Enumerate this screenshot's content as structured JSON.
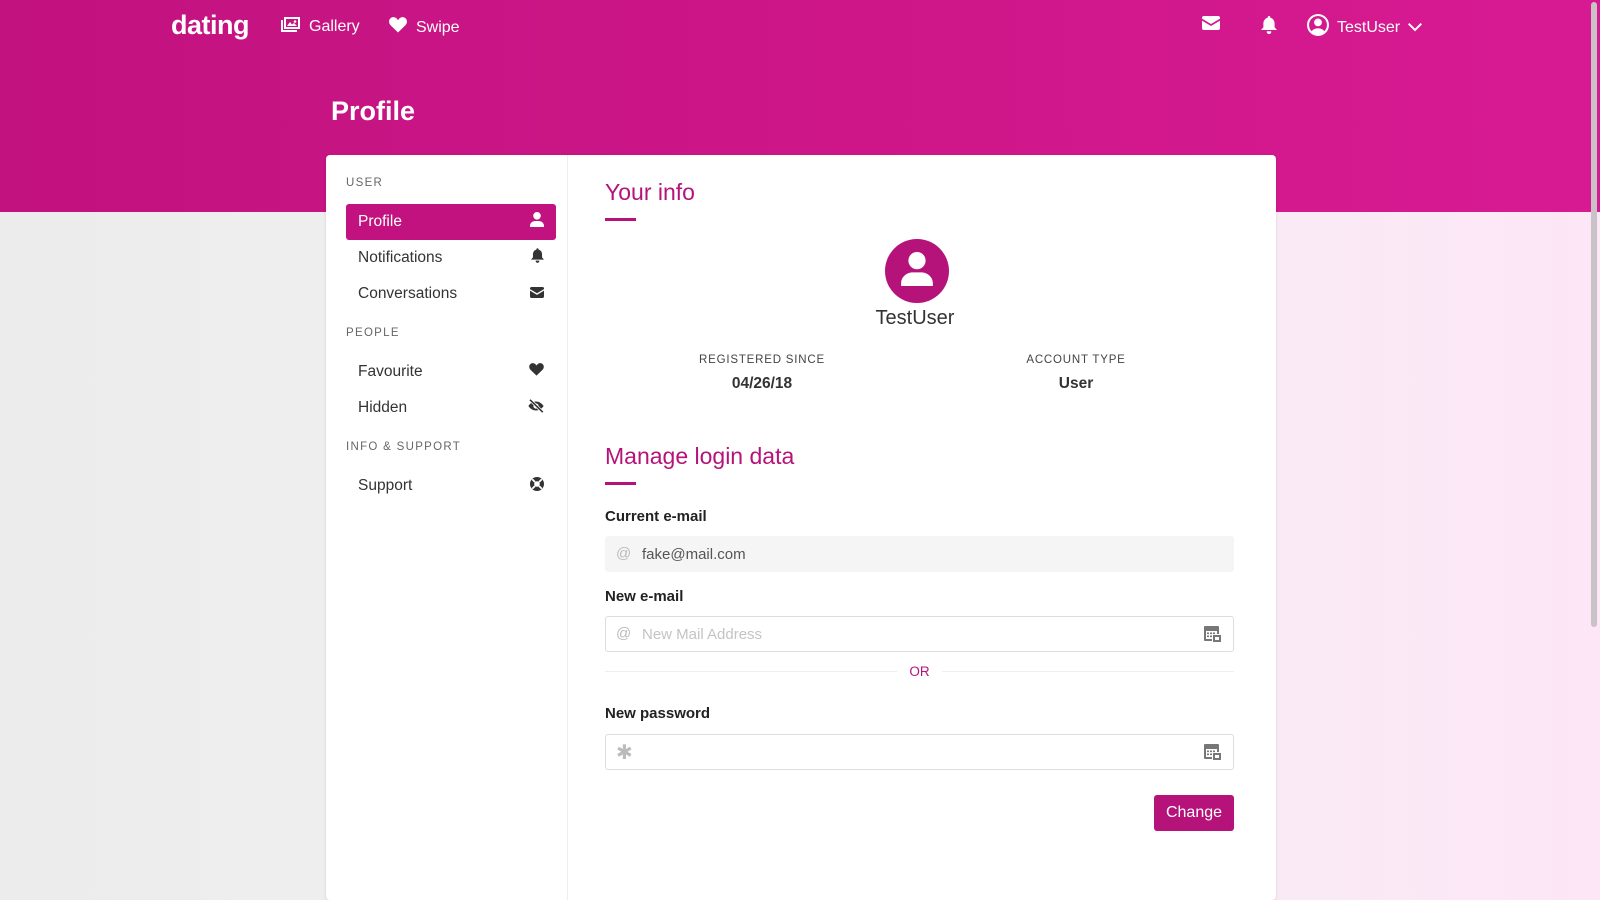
{
  "nav": {
    "logo": "dating",
    "links": [
      {
        "label": "Gallery",
        "icon": "image-icon"
      },
      {
        "label": "Swipe",
        "icon": "heart-icon"
      }
    ],
    "icons": [
      "envelope-icon",
      "bell-icon"
    ],
    "user": {
      "name": "TestUser",
      "icon": "user-circle-icon"
    }
  },
  "page": {
    "title": "Profile"
  },
  "sidebar": {
    "sections": [
      {
        "label": "USER",
        "items": [
          {
            "label": "Profile",
            "icon": "user-icon",
            "active": true
          },
          {
            "label": "Notifications",
            "icon": "bell-icon"
          },
          {
            "label": "Conversations",
            "icon": "envelope-icon"
          }
        ]
      },
      {
        "label": "PEOPLE",
        "items": [
          {
            "label": "Favourite",
            "icon": "heart-icon"
          },
          {
            "label": "Hidden",
            "icon": "eye-slash-icon"
          }
        ]
      },
      {
        "label": "INFO & SUPPORT",
        "items": [
          {
            "label": "Support",
            "icon": "life-ring-icon"
          }
        ]
      }
    ]
  },
  "info": {
    "heading": "Your info",
    "username": "TestUser",
    "registered_label": "REGISTERED SINCE",
    "registered_value": "04/26/18",
    "account_label": "ACCOUNT TYPE",
    "account_value": "User"
  },
  "login": {
    "heading": "Manage login data",
    "current_email_label": "Current e-mail",
    "current_email_value": "fake@mail.com",
    "new_email_label": "New e-mail",
    "new_email_placeholder": "New Mail Address",
    "or_text": "OR",
    "new_password_label": "New password",
    "new_password_value": "",
    "submit_label": "Change"
  },
  "colors": {
    "brand": "#c2127f",
    "accent_text": "#b5127a"
  }
}
